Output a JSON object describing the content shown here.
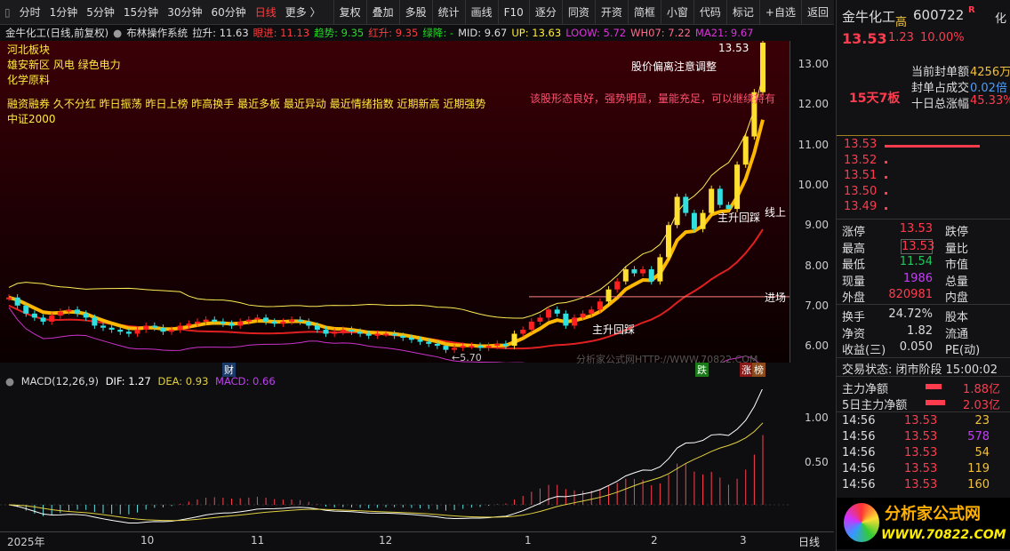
{
  "toolbar": {
    "periods": [
      "分时",
      "1分钟",
      "5分钟",
      "15分钟",
      "30分钟",
      "60分钟",
      "日线",
      "更多 〉"
    ],
    "active": "日线",
    "actions": [
      "复权",
      "叠加",
      "多股",
      "统计",
      "画线",
      "F10",
      "逐分",
      "同资",
      "开资",
      "简框",
      "小窗",
      "代码",
      "标记",
      "+自选",
      "返回"
    ]
  },
  "info": {
    "title": "金牛化工(日线,前复权)",
    "system": "布林操作系统",
    "items": [
      {
        "text": "拉升: 11.63",
        "color": "#dddddd"
      },
      {
        "text": "眼进: 11.13",
        "color": "#ff3b3b"
      },
      {
        "text": "趋势: 9.35",
        "color": "#22dd22"
      },
      {
        "text": "红升: 9.35",
        "color": "#ff3b3b"
      },
      {
        "text": "绿降: -",
        "color": "#22dd22"
      },
      {
        "text": "MID: 9.67",
        "color": "#dddddd"
      },
      {
        "text": "UP: 13.63",
        "color": "#ffee33"
      },
      {
        "text": "LOOW: 5.72",
        "color": "#dd33dd"
      },
      {
        "text": "WH07: 7.22",
        "color": "#ff6b8b"
      },
      {
        "text": "MA21: 9.67",
        "color": "#dd33dd"
      }
    ]
  },
  "tags": [
    "河北板块",
    "雄安新区 风电 绿色电力",
    "化学原料",
    "融资融券 久不分红 昨日振荡 昨日上榜 昨高换手 最近多板 最近异动 最近情绪指数 近期新高 近期强势",
    "中证2000"
  ],
  "annotations": {
    "high_label": "13.53",
    "warn": "股价偏离注意调整",
    "comment": "该股形态良好，强势明显，量能充足，可以继续持有",
    "rise1": "主升回踩",
    "rise2": "主升回踩",
    "online": "线上",
    "entry": "进场",
    "low_label": "←5.70",
    "watermark": "分析家公式网HTTP://WWW.70822.COM",
    "cai": "财",
    "die": "跌",
    "zhang": "涨",
    "bang": "榜"
  },
  "macd": {
    "title": "MACD(12,26,9)",
    "dif": "DIF: 1.27",
    "dea": "DEA: 0.93",
    "macd": "MACD: 0.66",
    "ticks": [
      "1.00",
      "0.50"
    ]
  },
  "dates": [
    "2025年",
    "10",
    "11",
    "12",
    "1",
    "2",
    "3"
  ],
  "period_label": "日线",
  "chart_data": {
    "type": "candlestick",
    "yticks": [
      "13.00",
      "12.00",
      "11.00",
      "10.00",
      "9.00",
      "8.00",
      "7.00",
      "6.00"
    ],
    "ylim": [
      5.5,
      13.8
    ],
    "close": [
      7.2,
      7.0,
      6.8,
      6.7,
      6.6,
      6.75,
      6.85,
      6.9,
      6.8,
      6.7,
      6.5,
      6.45,
      6.4,
      6.35,
      6.3,
      6.4,
      6.5,
      6.45,
      6.35,
      6.4,
      6.5,
      6.55,
      6.6,
      6.65,
      6.6,
      6.55,
      6.5,
      6.6,
      6.65,
      6.7,
      6.6,
      6.55,
      6.6,
      6.65,
      6.6,
      6.5,
      6.4,
      6.3,
      6.35,
      6.4,
      6.35,
      6.3,
      6.25,
      6.3,
      6.3,
      6.25,
      6.2,
      6.15,
      6.1,
      6.05,
      6.0,
      5.9,
      5.95,
      6.0,
      6.0,
      5.95,
      6.0,
      6.05,
      6.0,
      6.3,
      6.4,
      6.6,
      6.7,
      6.9,
      6.8,
      6.5,
      6.7,
      6.8,
      6.9,
      7.1,
      7.4,
      7.6,
      7.9,
      7.8,
      7.9,
      7.6,
      8.2,
      9.0,
      9.7,
      9.3,
      8.9,
      9.3,
      9.9,
      9.5,
      9.4,
      10.5,
      11.2,
      12.3,
      13.53
    ],
    "entry_line": 7.22
  },
  "quote": {
    "name": "金牛化工",
    "flag": "高",
    "code": "600722",
    "r": "R",
    "side": "化",
    "price": "13.53",
    "change": "1.23",
    "pct": "10.00%",
    "streak": "15天7板",
    "seal": [
      {
        "k": "当前封单额",
        "v": "4256万",
        "c": "yel"
      },
      {
        "k": "封单占成交",
        "v": "0.02倍",
        "c": "blue"
      },
      {
        "k": "十日总涨幅",
        "v": "45.33%",
        "c": "red"
      }
    ],
    "book": [
      "13.53",
      "13.52",
      "13.51",
      "13.50",
      "13.49"
    ],
    "stats": [
      [
        "涨停",
        "13.53",
        "red",
        "跌停"
      ],
      [
        "最高",
        "13.53",
        "red",
        "量比"
      ],
      [
        "最低",
        "11.54",
        "green",
        "市值"
      ],
      [
        "现量",
        "1986",
        "pur",
        "总量"
      ],
      [
        "外盘",
        "820981",
        "red",
        "内盘"
      ]
    ],
    "stats2": [
      [
        "换手",
        "24.72%",
        "股本"
      ],
      [
        "净资",
        "1.82",
        "流通"
      ],
      [
        "收益(三)",
        "0.050",
        "PE(动)"
      ]
    ],
    "status": "交易状态: 闭市阶段 15:00:02",
    "flow": [
      {
        "k": "主力净额",
        "v": "1.88亿"
      },
      {
        "k": "5日主力净额",
        "v": "2.03亿"
      }
    ],
    "ticks": [
      [
        "14:56",
        "13.53",
        "23",
        "yel"
      ],
      [
        "14:56",
        "13.53",
        "578",
        "pur"
      ],
      [
        "14:56",
        "13.53",
        "54",
        "yel"
      ],
      [
        "14:56",
        "13.53",
        "119",
        "yel"
      ],
      [
        "14:56",
        "13.53",
        "160",
        "yel"
      ]
    ],
    "logo_cn": "分析家公式网",
    "logo_url": "WWW.70822.COM"
  }
}
